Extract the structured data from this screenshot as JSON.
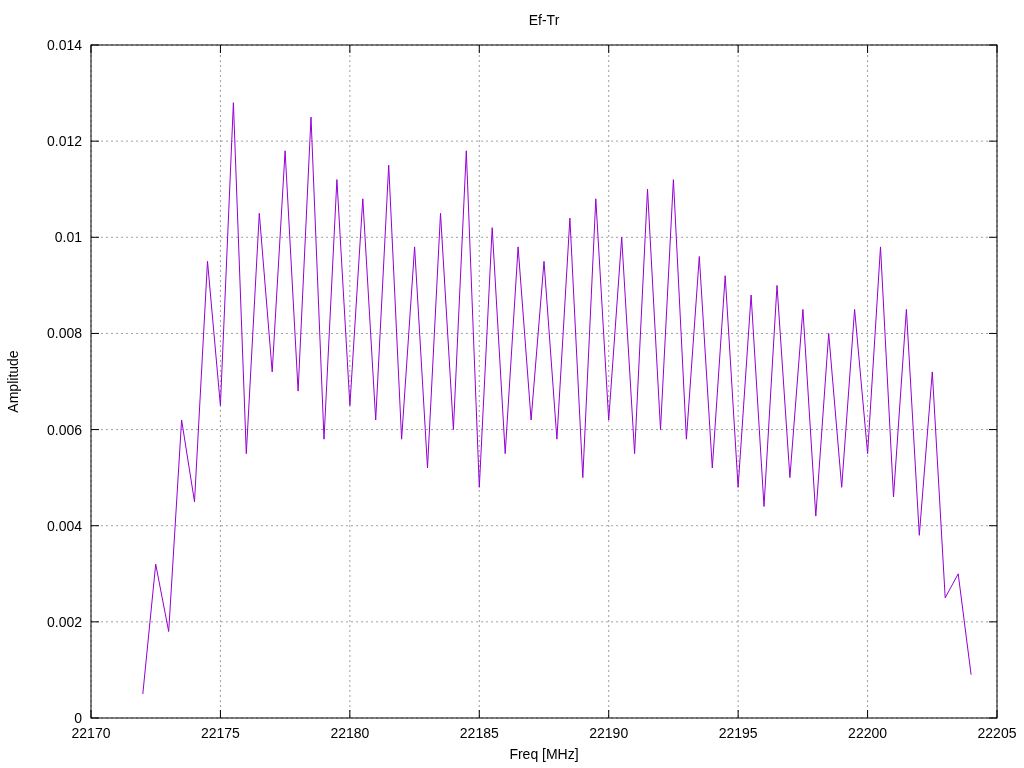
{
  "chart_data": {
    "type": "line",
    "title": "Ef-Tr",
    "grid": true,
    "xlabel": "Freq [MHz]",
    "ylabel": "Amplitude",
    "xlim": [
      22170,
      22205
    ],
    "ylim": [
      0,
      0.014
    ],
    "xticks": [
      22170,
      22175,
      22180,
      22185,
      22190,
      22195,
      22200,
      22205
    ],
    "yticks": [
      {
        "value": 0,
        "label": "0"
      },
      {
        "value": 0.002,
        "label": "0.002"
      },
      {
        "value": 0.004,
        "label": "0.004"
      },
      {
        "value": 0.006,
        "label": "0.006"
      },
      {
        "value": 0.008,
        "label": "0.008"
      },
      {
        "value": 0.01,
        "label": "0.01"
      },
      {
        "value": 0.012,
        "label": "0.012"
      },
      {
        "value": 0.014,
        "label": "0.014"
      }
    ],
    "x": [
      22172,
      22172.5,
      22173,
      22173.5,
      22174,
      22174.5,
      22175,
      22175.5,
      22176,
      22176.5,
      22177,
      22177.5,
      22178,
      22178.5,
      22179,
      22179.5,
      22180,
      22180.5,
      22181,
      22181.5,
      22182,
      22182.5,
      22183,
      22183.5,
      22184,
      22184.5,
      22185,
      22185.5,
      22186,
      22186.5,
      22187,
      22187.5,
      22188,
      22188.5,
      22189,
      22189.5,
      22190,
      22190.5,
      22191,
      22191.5,
      22192,
      22192.5,
      22193,
      22193.5,
      22194,
      22194.5,
      22195,
      22195.5,
      22196,
      22196.5,
      22197,
      22197.5,
      22198,
      22198.5,
      22199,
      22199.5,
      22200,
      22200.5,
      22201,
      22201.5,
      22202,
      22202.5,
      22203,
      22203.5,
      22204
    ],
    "series": [
      {
        "color": "#9400d3",
        "values": [
          0.0005,
          0.0032,
          0.0018,
          0.0062,
          0.0045,
          0.0095,
          0.0065,
          0.0128,
          0.0055,
          0.0105,
          0.0072,
          0.0118,
          0.0068,
          0.0125,
          0.0058,
          0.0112,
          0.0065,
          0.0108,
          0.0062,
          0.0115,
          0.0058,
          0.0098,
          0.0052,
          0.0105,
          0.006,
          0.0118,
          0.0048,
          0.0102,
          0.0055,
          0.0098,
          0.0062,
          0.0095,
          0.0058,
          0.0104,
          0.005,
          0.0108,
          0.0062,
          0.01,
          0.0055,
          0.011,
          0.006,
          0.0112,
          0.0058,
          0.0096,
          0.0052,
          0.0092,
          0.0048,
          0.0088,
          0.0044,
          0.009,
          0.005,
          0.0085,
          0.0042,
          0.008,
          0.0048,
          0.0085,
          0.0055,
          0.0098,
          0.0046,
          0.0085,
          0.0038,
          0.0072,
          0.0025,
          0.003,
          0.0009
        ]
      }
    ]
  }
}
